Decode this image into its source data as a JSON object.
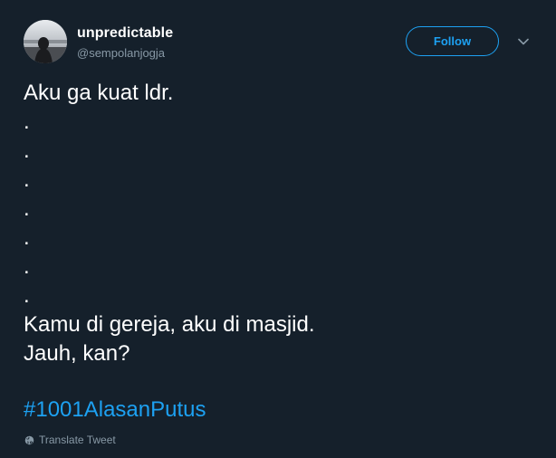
{
  "user": {
    "name": "unpredictable",
    "handle": "@sempolanjogja"
  },
  "follow_label": "Follow",
  "tweet_lines": [
    "Aku ga kuat ldr.",
    ".",
    ".",
    ".",
    ".",
    ".",
    ".",
    ".",
    "Kamu di gereja, aku di masjid.",
    "Jauh, kan?"
  ],
  "hashtag": "#1001AlasanPutus",
  "translate_label": "Translate Tweet",
  "colors": {
    "background": "#15202b",
    "accent": "#1da1f2",
    "secondary_text": "#8899a6"
  }
}
